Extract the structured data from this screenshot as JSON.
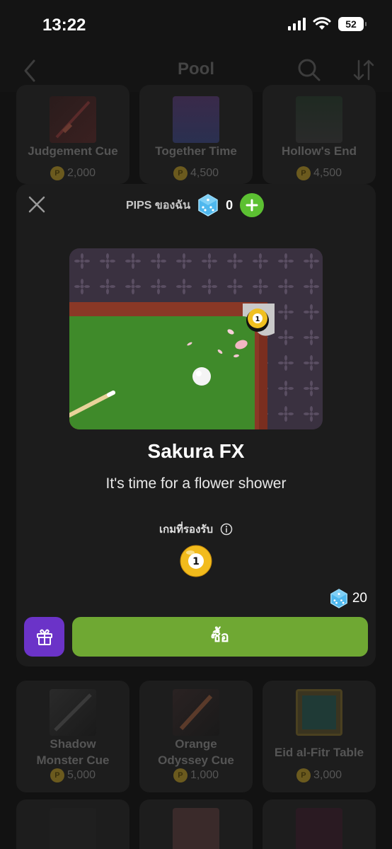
{
  "status_bar": {
    "time": "13:22",
    "battery": "52"
  },
  "header": {
    "title": "Pool"
  },
  "cards": [
    {
      "name": "Judgement Cue",
      "price": "2,000"
    },
    {
      "name": "Together Time",
      "price": "4,500"
    },
    {
      "name": "Hollow's End",
      "price": "4,500"
    },
    {
      "name": "Shadow Monster Cue",
      "price": "5,000"
    },
    {
      "name": "Orange Odyssey Cue",
      "price": "1,000"
    },
    {
      "name": "Eid al-Fitr Table",
      "price": "3,000"
    }
  ],
  "coin_symbol": "P",
  "modal": {
    "pips_label": "PIPS ของฉัน",
    "pips_count": "0",
    "title": "Sakura FX",
    "description": "It's time for a flower shower",
    "supported_label": "เกมที่รองรับ",
    "supported_game_ball_number": "1",
    "preview_ball_number": "1",
    "cost": "20",
    "buy_label": "ซื้อ"
  },
  "colors": {
    "buy_button": "#6fa833",
    "gift_button": "#6b33c8",
    "plus_button": "#5cc032",
    "pips_gem": "#4fb8ee"
  },
  "icons": [
    "back-arrow-icon",
    "search-icon",
    "sort-icon",
    "close-icon",
    "dice-gem-icon",
    "plus-icon",
    "info-icon",
    "gift-icon",
    "pool-ball-icon",
    "coin-icon"
  ]
}
